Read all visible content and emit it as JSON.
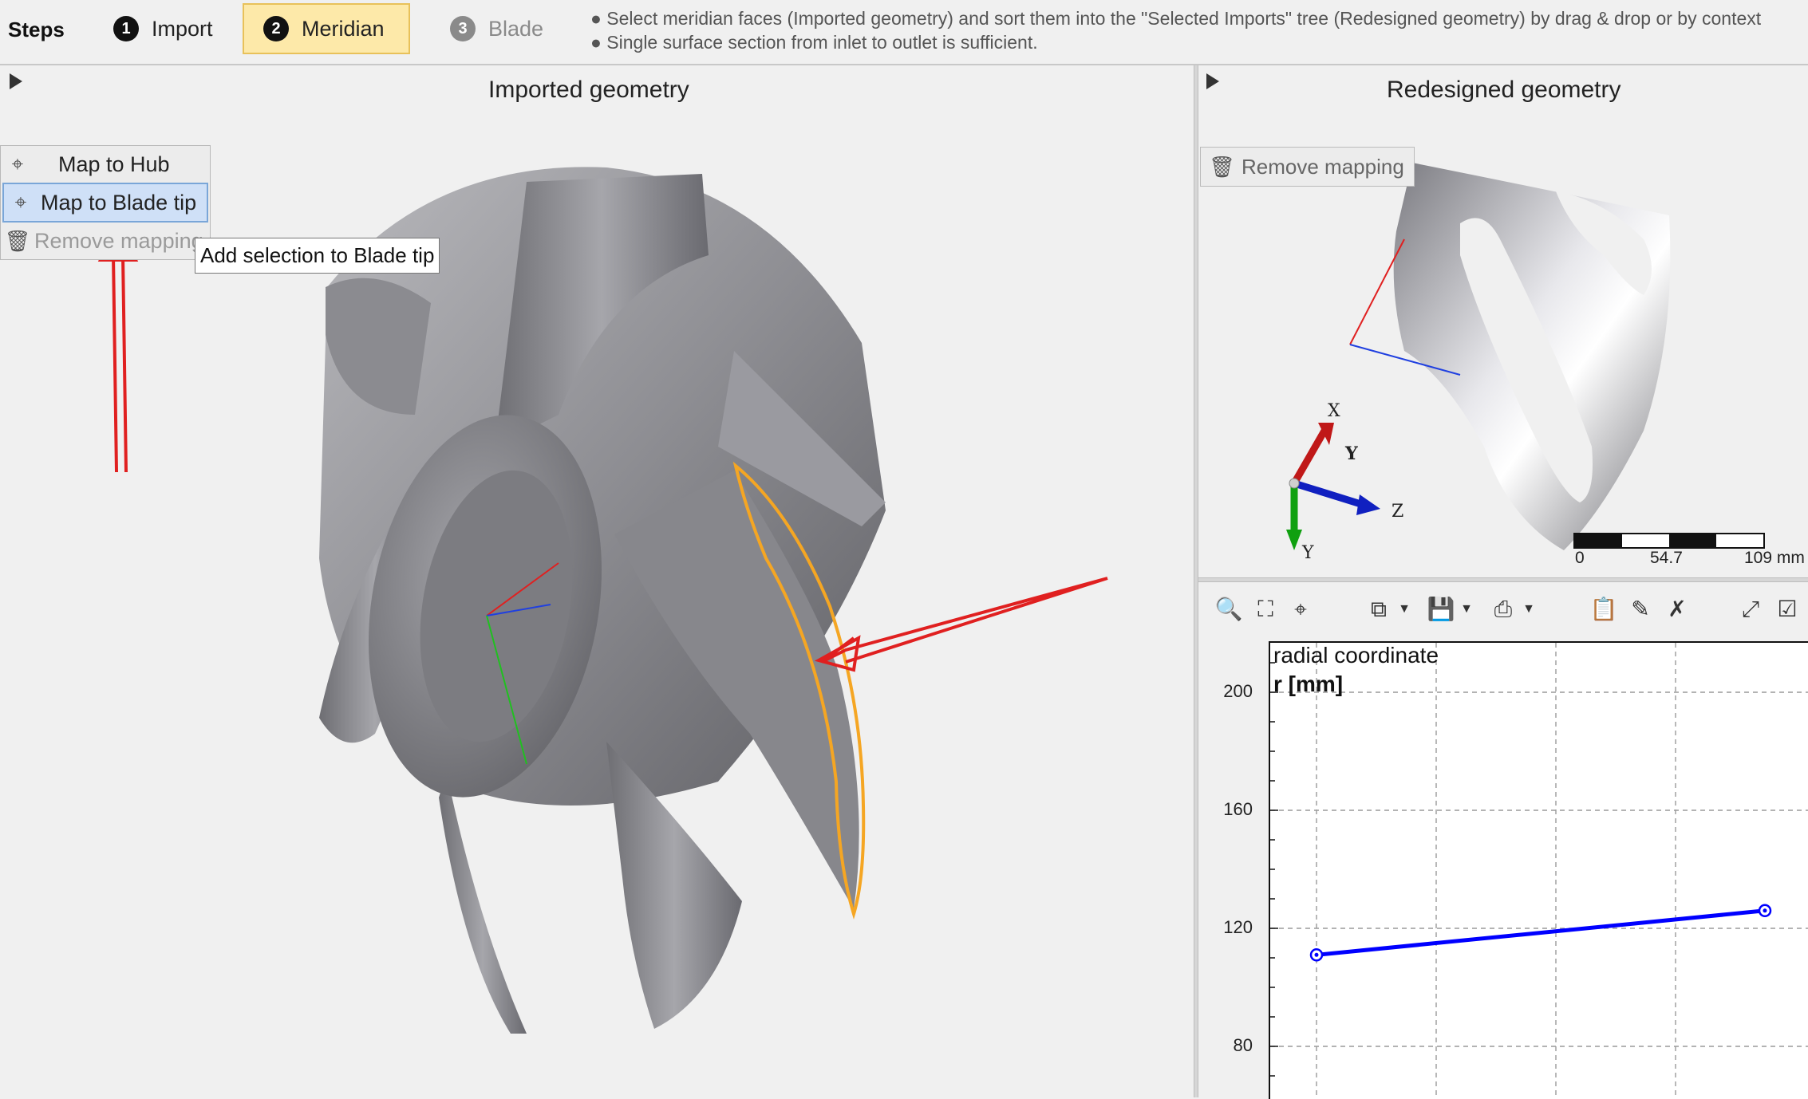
{
  "steps": {
    "label": "Steps",
    "items": [
      {
        "num": "1",
        "label": "Import",
        "state": "done"
      },
      {
        "num": "2",
        "label": "Meridian",
        "state": "active"
      },
      {
        "num": "3",
        "label": "Blade",
        "state": "disabled"
      }
    ]
  },
  "hints": [
    "● Select meridian faces (Imported geometry) and sort them into the \"Selected Imports\" tree (Redesigned geometry) by drag & drop or by context",
    "● Single surface section from inlet to outlet is sufficient."
  ],
  "left_panel": {
    "title": "Imported geometry",
    "context_menu": {
      "items": [
        {
          "label": "Map to Hub",
          "icon": "crosshair-icon"
        },
        {
          "label": "Map to Blade tip",
          "icon": "crosshair-icon"
        },
        {
          "label": "Remove mapping",
          "icon": "trash-icon"
        }
      ]
    },
    "tooltip": "Add selection to Blade tip"
  },
  "right_panel": {
    "title": "Redesigned geometry",
    "remove_mapping": "Remove mapping",
    "axes": {
      "x": "X",
      "y": "Y",
      "z": "Z",
      "w": "Y"
    },
    "scale": {
      "labels": [
        "0",
        "54.7",
        "109 mm"
      ]
    }
  },
  "plot_panel": {
    "toolbar_icons": [
      "zoom-icon",
      "fit-view-icon",
      "crosshair-icon",
      "copy-icon",
      "save-icon",
      "print-icon",
      "paste-icon",
      "edit-icon",
      "clear-icon",
      "expand-icon",
      "checklist-icon"
    ],
    "ylabel_line1": "radial coordinate",
    "ylabel_line2": "r [mm]",
    "yticks": [
      "200",
      "160",
      "120",
      "80"
    ]
  },
  "chart_data": {
    "type": "line",
    "ylabel": "radial coordinate r [mm]",
    "ylim": [
      60,
      215
    ],
    "grid": true,
    "series": [
      {
        "x": [
          0,
          1
        ],
        "y": [
          111,
          126
        ],
        "color": "#0000ff"
      }
    ]
  },
  "colors": {
    "accent": "#fde9a9",
    "selection": "#f5a623",
    "annotation": "#e02020",
    "series": "#0000ff"
  }
}
